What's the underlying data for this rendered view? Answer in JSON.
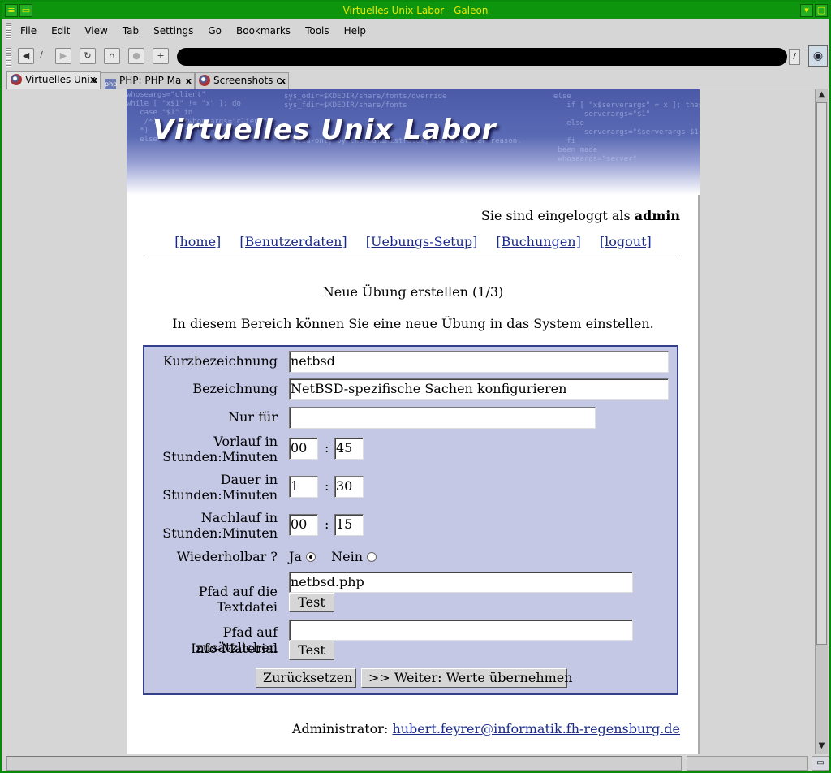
{
  "window": {
    "title": "Virtuelles Unix Labor - Galeon"
  },
  "menu": [
    "File",
    "Edit",
    "View",
    "Tab",
    "Settings",
    "Go",
    "Bookmarks",
    "Tools",
    "Help"
  ],
  "toolbar": {
    "icons": [
      "back-icon",
      "back-history-icon",
      "forward-icon",
      "reload-icon",
      "home-icon",
      "stop-icon",
      "new-tab-icon"
    ],
    "url_redacted": true
  },
  "tabs": [
    {
      "label": "Virtuelles Unix",
      "icon": "galeon-icon",
      "active": true
    },
    {
      "label": "PHP: PHP Ma",
      "icon": "php-icon",
      "active": false
    },
    {
      "label": "Screenshots c",
      "icon": "galeon-icon",
      "active": false
    }
  ],
  "page": {
    "banner_title": "Virtuelles Unix Labor",
    "login_prefix": "Sie sind eingeloggt als",
    "login_user": "admin",
    "nav": [
      "[home]",
      "[Benutzerdaten]",
      "[Uebungs-Setup]",
      "[Buchungen]",
      "[logout]"
    ],
    "heading": "Neue Übung erstellen (1/3)",
    "intro": "In diesem Bereich können Sie eine neue Übung in das System einstellen.",
    "form": {
      "kurz_label": "Kurzbezeichnung",
      "kurz_value": "netbsd",
      "bez_label": "Bezeichnung",
      "bez_value": "NetBSD-spezifische Sachen konfigurieren",
      "nur_label": "Nur für",
      "nur_value": "",
      "vorlauf_label_1": "Vorlauf in",
      "vorlauf_label_2": "Stunden:Minuten",
      "vorlauf_h": "00",
      "vorlauf_m": "45",
      "dauer_label_1": "Dauer in",
      "dauer_label_2": "Stunden:Minuten",
      "dauer_h": "1",
      "dauer_m": "30",
      "nachlauf_label_1": "Nachlauf in",
      "nachlauf_label_2": "Stunden:Minuten",
      "nachlauf_h": "00",
      "nachlauf_m": "15",
      "colon": ":",
      "wiederholbar_label": "Wiederholbar ?",
      "ja_label": "Ja",
      "nein_label": "Nein",
      "wiederholbar_selected": "Ja",
      "pfad_label": "Pfad auf die Textdatei",
      "pfad_value": "netbsd.php",
      "test_label": "Test",
      "info_label_1": "Pfad auf zusätzlichen",
      "info_label_2": "Info-Material",
      "info_value": "",
      "reset_label": "Zurücksetzen",
      "submit_label": ">> Weiter: Werte übernehmen"
    },
    "footer_prefix": "Administrator:",
    "footer_email": "hubert.feyrer@informatik.fh-regensburg.de"
  },
  "colors": {
    "titlebar": "#0d960d",
    "titlebar_text": "#e8e800",
    "form_background": "#c4c8e4",
    "form_border": "#34408a",
    "link": "#1a2a8a"
  }
}
